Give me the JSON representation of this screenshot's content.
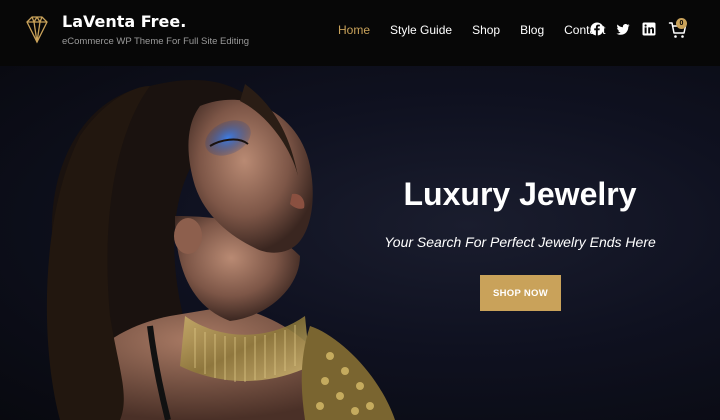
{
  "site": {
    "title": "LaVenta Free.",
    "tagline": "eCommerce WP Theme For Full Site Editing",
    "logo_icon": "diamond-icon"
  },
  "nav": {
    "items": [
      {
        "label": "Home",
        "active": true
      },
      {
        "label": "Style Guide",
        "active": false
      },
      {
        "label": "Shop",
        "active": false
      },
      {
        "label": "Blog",
        "active": false
      },
      {
        "label": "Contact",
        "active": false
      }
    ]
  },
  "social": {
    "icons": [
      "facebook-icon",
      "twitter-icon",
      "linkedin-icon"
    ]
  },
  "cart": {
    "icon": "cart-icon",
    "count": "0"
  },
  "hero": {
    "title": "Luxury Jewelry",
    "subtitle": "Your Search For Perfect Jewelry Ends Here",
    "button_label": "SHOP NOW"
  },
  "colors": {
    "accent": "#c9a25a",
    "header_bg": "#070707",
    "hero_bg": "#0f1120"
  }
}
